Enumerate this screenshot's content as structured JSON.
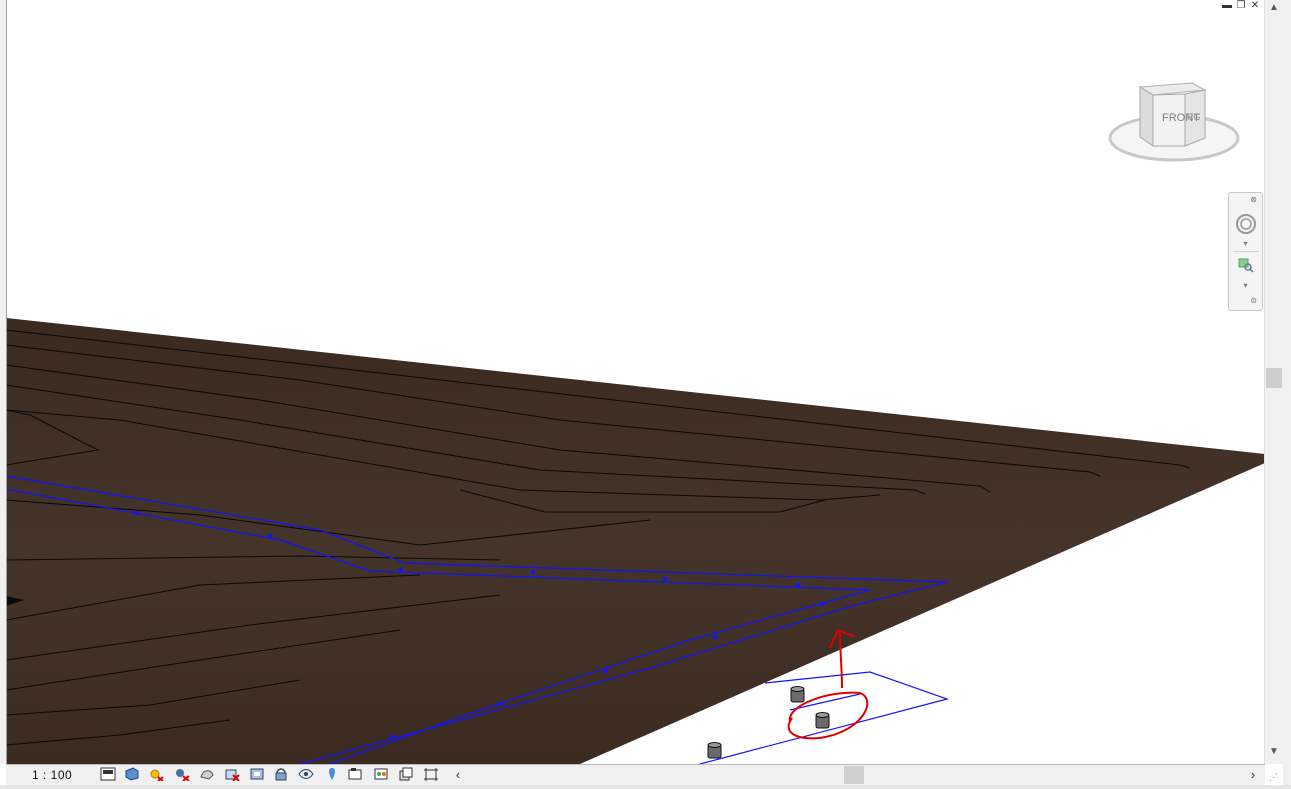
{
  "window": {
    "controls": [
      "minimize",
      "restore",
      "close"
    ],
    "control_glyphs": {
      "minimize": "▬",
      "restore": "❐",
      "close": "✕"
    }
  },
  "viewcube": {
    "front_label": "FRONT",
    "right_label": "RG"
  },
  "navbar": {
    "tools": [
      "steering-wheel",
      "zoom"
    ]
  },
  "viewbar": {
    "scale": "1 : 100",
    "icons": [
      "detail-level-icon",
      "visual-style-icon",
      "sun-path-icon",
      "shadows-icon",
      "render-icon",
      "crop-view-icon",
      "show-crop-icon",
      "unlock-3d-icon",
      "temporary-hide-icon",
      "reveal-hidden-icon",
      "temporary-view-properties-icon",
      "analytical-model-icon",
      "highlight-displacement-icon",
      "constraints-icon"
    ]
  },
  "scrollbars": {
    "up": "▲",
    "down": "▼",
    "left": "‹",
    "right": "›"
  },
  "colors": {
    "terrain": "#3d2c22",
    "terrain_line": "#0a0806",
    "property_line": "#1010ff",
    "annotation": "#e00000",
    "background": "#ffffff"
  }
}
